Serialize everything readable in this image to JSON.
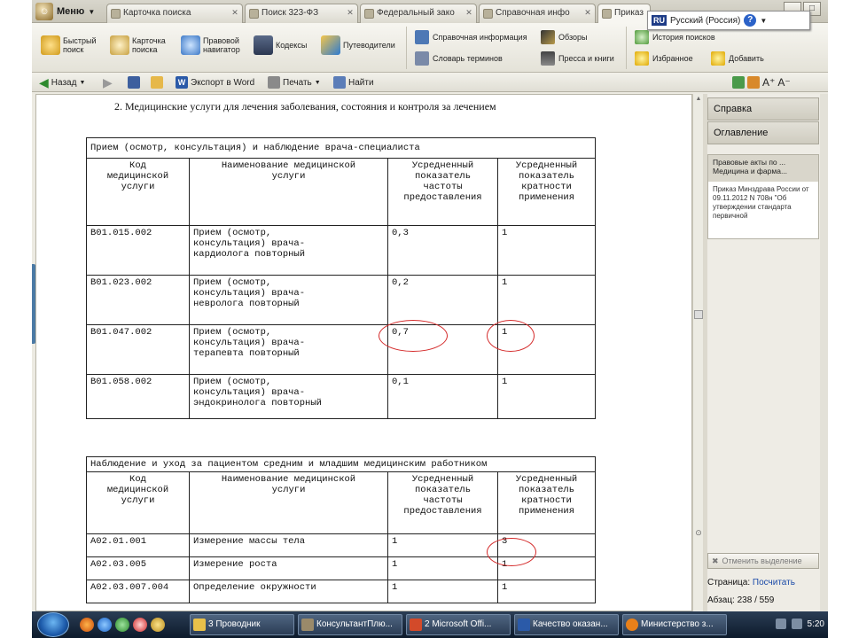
{
  "tabs": {
    "menu_label": "Меню",
    "items": [
      {
        "label": "Карточка поиска"
      },
      {
        "label": "Поиск 323-ФЗ"
      },
      {
        "label": "Федеральный зако"
      },
      {
        "label": "Справочная инфо"
      },
      {
        "label": "Приказ"
      }
    ],
    "language": {
      "code": "RU",
      "label": "Русский (Россия)",
      "help": "?"
    }
  },
  "ribbon": {
    "quick_search": "Быстрый поиск",
    "search_card": "Карточка поиска",
    "legal_navigator": "Правовой навигатор",
    "codes": "Кодексы",
    "guides": "Путеводители",
    "reference_info": "Справочная информация",
    "glossary": "Словарь терминов",
    "reviews": "Обзоры",
    "press_books": "Пресса и книги",
    "search_history": "История поисков",
    "favorites": "Избранное",
    "add": "Добавить"
  },
  "toolbar": {
    "back": "Назад",
    "export_word": "Экспорт в Word",
    "print": "Печать",
    "find": "Найти"
  },
  "document": {
    "heading": "2. Медицинские услуги для лечения заболевания, состояния и контроля за лечением",
    "table1": {
      "title": "Прием (осмотр, консультация) и наблюдение врача-специалиста",
      "headers": [
        "Код\nмедицинской\nуслуги",
        "Наименование медицинской\nуслуги",
        "Усредненный\nпоказатель\nчастоты\nпредоставления",
        "Усредненный\nпоказатель\nкратности\nприменения"
      ],
      "rows": [
        [
          "B01.015.002",
          "Прием (осмотр,\nконсультация) врача-\nкардиолога повторный",
          "0,3",
          "1"
        ],
        [
          "B01.023.002",
          "Прием (осмотр,\nконсультация) врача-\nневролога повторный",
          "0,2",
          "1"
        ],
        [
          "B01.047.002",
          "Прием (осмотр,\nконсультация) врача-\nтерапевта повторный",
          "0,7",
          "1"
        ],
        [
          "B01.058.002",
          "Прием (осмотр,\nконсультация) врача-\nэндокринолога повторный",
          "0,1",
          "1"
        ]
      ]
    },
    "table2": {
      "title": "Наблюдение и уход за пациентом средним и младшим медицинским работником",
      "headers": [
        "Код\nмедицинской\nуслуги",
        "Наименование медицинской\nуслуги",
        "Усредненный\nпоказатель\nчастоты\nпредоставления",
        "Усредненный\nпоказатель\nкратности\nприменения"
      ],
      "rows": [
        [
          "A02.01.001",
          "Измерение массы тела",
          "1",
          "3"
        ],
        [
          "A02.03.005",
          "Измерение роста",
          "1",
          "1"
        ],
        [
          "A02.03.007.004",
          "Определение окружности",
          "1",
          "1"
        ]
      ]
    }
  },
  "right_panel": {
    "help_tab": "Справка",
    "contents_tab": "Оглавление",
    "box_title": "Правовые акты по ... Медицина и фарма...",
    "box_body": "Приказ Минздрава России от 09.11.2012 N 708н \"Об утверждении стандарта первичной",
    "clear_selection": "Отменить выделение",
    "page_label": "Страница:",
    "page_link": "Посчитать",
    "paragraph_label": "Абзац:",
    "paragraph_value": "238 / 559"
  },
  "taskbar": {
    "tasks": [
      {
        "label": "3 Проводник"
      },
      {
        "label": "КонсультантПлю..."
      },
      {
        "label": "2 Microsoft Offi..."
      },
      {
        "label": "Качество оказан..."
      },
      {
        "label": "Министерство з..."
      }
    ],
    "clock": "5:20"
  },
  "colors": {
    "annotation_circle": "#d42a2a",
    "link": "#1a4aa8",
    "taskbar": "#1a2b40"
  }
}
